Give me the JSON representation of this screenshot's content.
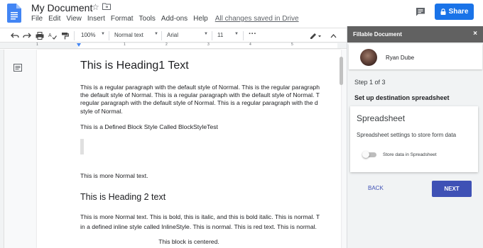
{
  "header": {
    "title": "My Document",
    "menu": [
      "File",
      "Edit",
      "View",
      "Insert",
      "Format",
      "Tools",
      "Add-ons",
      "Help"
    ],
    "saved_status": "All changes saved in Drive",
    "share_label": "Share"
  },
  "toolbar": {
    "zoom": "100%",
    "style": "Normal text",
    "font": "Arial",
    "font_size": "11",
    "more": "···"
  },
  "ruler": {
    "numbers": [
      "1",
      "1",
      "2",
      "3",
      "4",
      "5"
    ]
  },
  "document": {
    "heading1": "This is Heading1 Text",
    "paragraph_lines": [
      "This is a regular paragraph with the default style of Normal. This is the regular paragraph",
      "the default style of Normal. This is a regular paragraph with the default style of Normal. T",
      "regular paragraph with the default style of Normal. This is a regular paragraph with the d",
      "style of Normal."
    ],
    "block_style_text": "This is a Defined Block Style Called BlockStyleTest",
    "more_normal": "This is more Normal text.",
    "heading2": "This is Heading 2 text",
    "inline_lines": [
      "This is more Normal text. This is bold, this is italic, and this is bold italic. This is normal. T",
      "in a defined inline style called InlineStyle. This is normal. This is red text. This is normal."
    ],
    "centered": "This block is centered."
  },
  "sidebar": {
    "header_title": "Fillable Document",
    "close": "×",
    "user_name": "Ryan Dube",
    "step": "Step 1 of 3",
    "step_title": "Set up destination spreadsheet",
    "card_title": "Spreadsheet",
    "card_desc": "Spreadsheet settings to store form data",
    "toggle_label": "Store data in Spreadsheet",
    "toggle_on": false,
    "back_label": "BACK",
    "next_label": "NEXT"
  },
  "colors": {
    "share_blue": "#1a73e8",
    "sidebar_header": "#616161",
    "next_button": "#3f51b5",
    "back_text": "#3f51b5"
  }
}
